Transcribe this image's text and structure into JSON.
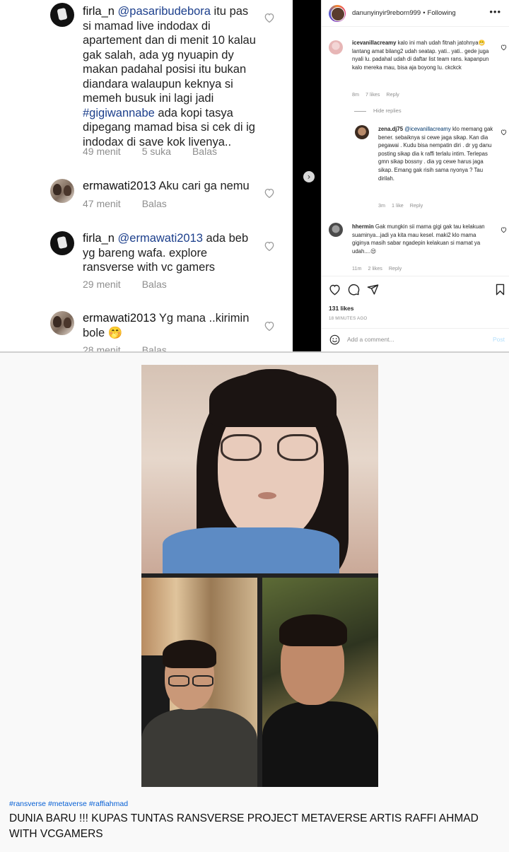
{
  "left_panel": {
    "comments": [
      {
        "user": "firla_n",
        "mention": "@pasaribudebora",
        "text_a": " itu pas si mamad live indodax di apartement dan di menit 10 kalau gak salah, ada yg nyuapin dy makan padahal posisi itu bukan diandara walaupun keknya si memeh busuk ini lagi jadi ",
        "hashtag": "#gigiwannabe",
        "text_b": " ada kopi tasya dipegang mamad bisa si cek di ig indodax di save kok livenya..",
        "time": "49 menit",
        "likes": "5 suka",
        "reply": "Balas"
      },
      {
        "user": "ermawati2013",
        "text": " Aku cari ga nemu",
        "time": "47 menit",
        "reply": "Balas"
      },
      {
        "user": "firla_n",
        "mention": "@ermawati2013",
        "text": " ada beb yg bareng wafa. explore ransverse with vc gamers",
        "time": "29 menit",
        "reply": "Balas"
      },
      {
        "user": "ermawati2013",
        "text": " Yg mana ..kirimin bole ",
        "emoji": "🤭",
        "time": "28 menit",
        "reply": "Balas"
      }
    ]
  },
  "right_panel": {
    "header": {
      "username": "danunyinyir9reborn999",
      "separator": "•",
      "follow": "Following",
      "more": "•••"
    },
    "comments": [
      {
        "user": "icevanillacreamy",
        "text_a": " kalo ini mah udah fitnah jatohnya",
        "emoji": "😬",
        "text_b": " lantang amat bilang2 udah seatap. yati.. yati.. gede juga nyali lu. padahal udah di daftar list team rans. kapanpun kalo mereka mau, bisa aja boyong lu. ckckck",
        "time": "8m",
        "likes": "7 likes",
        "reply": "Reply"
      },
      {
        "user": "zena.dj75",
        "mention": "@icevanillacreamy",
        "text": " klo memang gak bener. sebaiknya si cewe jaga sikap. Kan dia pegawai . Kudu bisa nempatin diri . dr yg danu posting sikap dia k raffi terlalu intim. Terlepas gmn sikap bossny . dia yg cewe harus jaga sikap. Emang gak risih sama nyonya ? Tau dirilah.",
        "time": "3m",
        "likes": "1 like",
        "reply": "Reply"
      },
      {
        "user": "hhermin",
        "text": " Gak mungkin sii mama gigi gak tau kelakuan suaminya...jadi ya kita mau kesel. maki2 klo mama giginya masih sabar ngadepin kelakuan si mamat ya udah....",
        "emoji": "😒",
        "time": "11m",
        "likes": "2 likes",
        "reply": "Reply"
      }
    ],
    "hide_replies": "Hide replies",
    "likes": "131 likes",
    "time_ago": "18 MINUTES AGO",
    "comment_placeholder": "Add a comment...",
    "post_label": "Post",
    "next_arrow": "›"
  },
  "video": {
    "hashtags": [
      "#ransverse",
      "#metaverse",
      "#raffiahmad"
    ],
    "title": "DUNIA BARU !!! KUPAS TUNTAS RANSVERSE PROJECT METAVERSE ARTIS RAFFI AHMAD WITH VCGAMERS"
  }
}
